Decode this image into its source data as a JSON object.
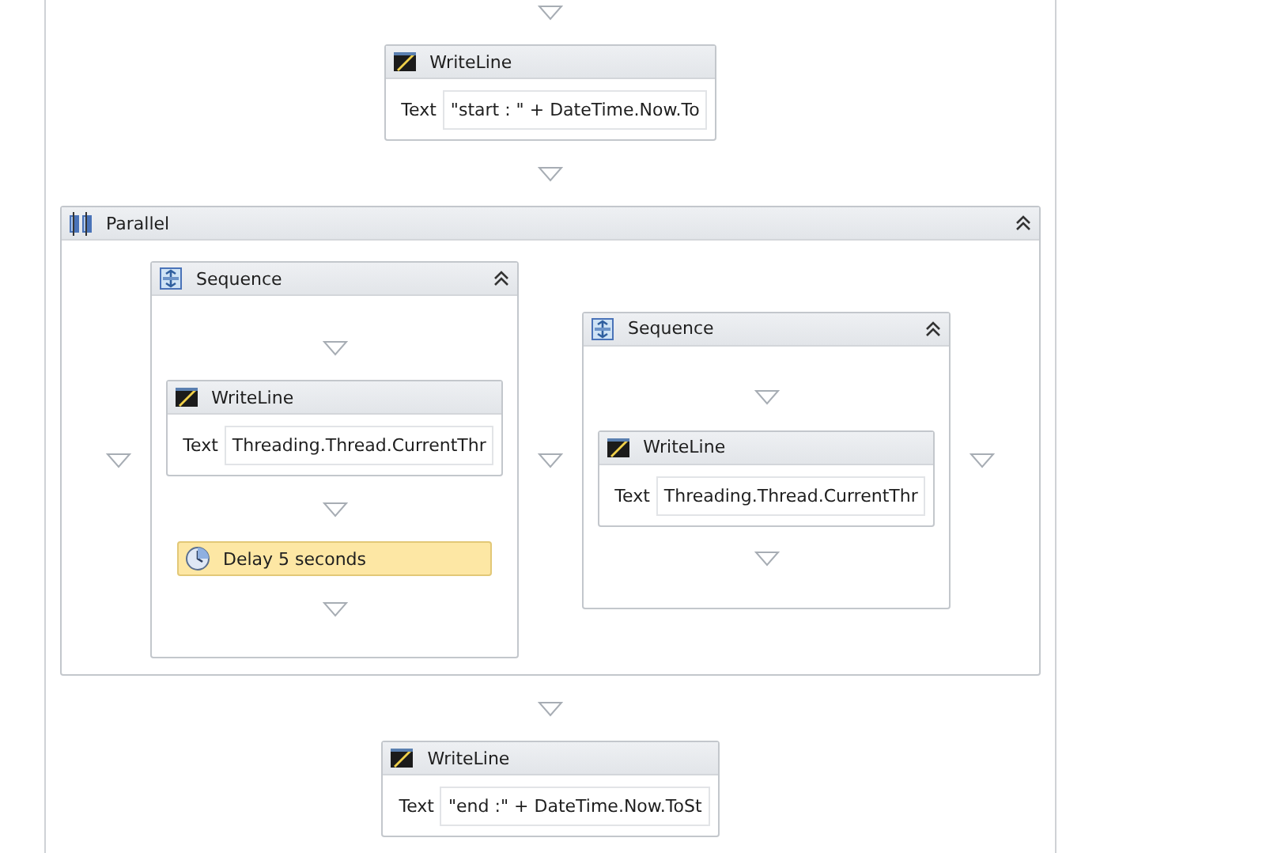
{
  "activities": [
    {
      "kind": "writeline",
      "title": "WriteLine",
      "field_label": "Text",
      "value": "\"start : \" + DateTime.Now.To"
    },
    {
      "kind": "parallel",
      "title": "Parallel",
      "expanded": true,
      "branches": [
        {
          "kind": "sequence",
          "title": "Sequence",
          "expanded": true,
          "children": [
            {
              "kind": "writeline",
              "title": "WriteLine",
              "field_label": "Text",
              "value": "Threading.Thread.CurrentThr"
            },
            {
              "kind": "delay",
              "title": "Delay 5 seconds"
            }
          ]
        },
        {
          "kind": "sequence",
          "title": "Sequence",
          "expanded": true,
          "children": [
            {
              "kind": "writeline",
              "title": "WriteLine",
              "field_label": "Text",
              "value": "Threading.Thread.CurrentThr"
            }
          ]
        }
      ]
    },
    {
      "kind": "writeline",
      "title": "WriteLine",
      "field_label": "Text",
      "value": "\"end :\" + DateTime.Now.ToSt"
    }
  ]
}
